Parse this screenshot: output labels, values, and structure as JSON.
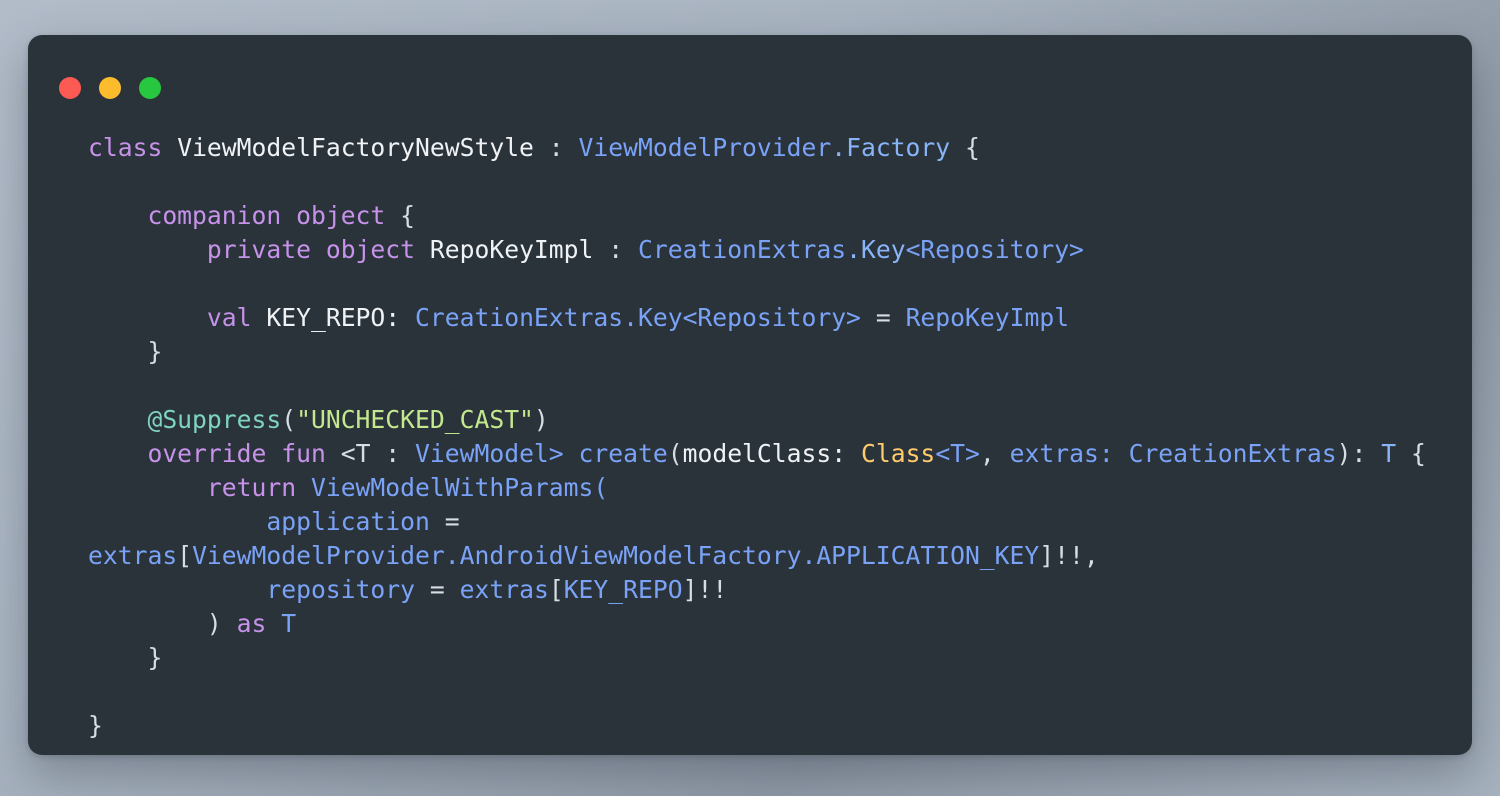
{
  "window": {
    "background_color": "#2a333a",
    "page_background_color": "#a9b4c1",
    "controls": [
      {
        "name": "close",
        "label": "Close",
        "color": "#fc5b54"
      },
      {
        "name": "minimize",
        "label": "Minimize",
        "color": "#fdbc2e"
      },
      {
        "name": "maximize",
        "label": "Maximize",
        "color": "#27c83f"
      }
    ]
  },
  "palette": {
    "keyword": "#c792ea",
    "identifier": "#f0f3f6",
    "type_reference": "#7aa2f7",
    "annotation": "#7fd4c1",
    "string": "#c3e88d",
    "gold_type": "#ffcb6b",
    "punctuation": "#d7dde3"
  },
  "code": {
    "language": "Kotlin",
    "lines": [
      "class ViewModelFactoryNewStyle : ViewModelProvider.Factory {",
      "",
      "    companion object {",
      "        private object RepoKeyImpl : CreationExtras.Key<Repository>",
      "",
      "        val KEY_REPO: CreationExtras.Key<Repository> = RepoKeyImpl",
      "    }",
      "",
      "    @Suppress(\"UNCHECKED_CAST\")",
      "    override fun <T : ViewModel> create(modelClass: Class<T>, extras: CreationExtras): T {",
      "        return ViewModelWithParams(",
      "            application =",
      "extras[ViewModelProvider.AndroidViewModelFactory.APPLICATION_KEY]!!,",
      "            repository = extras[KEY_REPO]!!",
      "        ) as T",
      "    }",
      "",
      "}"
    ],
    "tokens": {
      "l1": {
        "kw": "class",
        "name": "ViewModelFactoryNewStyle",
        "colon": ":",
        "super": "ViewModelProvider",
        "dot_member": ".Factory",
        "brace": "{"
      },
      "l3": {
        "kw1": "companion",
        "kw2": "object",
        "brace": "{"
      },
      "l4": {
        "kw1": "private",
        "kw2": "object",
        "name": "RepoKeyImpl",
        "colon": ":",
        "type": "CreationExtras",
        "member": ".Key",
        "generic": "<Repository>"
      },
      "l6": {
        "kw": "val",
        "name": "KEY_REPO:",
        "type": "CreationExtras.Key<Repository>",
        "eq": "=",
        "value": "RepoKeyImpl"
      },
      "l7": {
        "brace": "}"
      },
      "l9": {
        "annotation": "@Suppress",
        "open": "(",
        "string": "\"UNCHECKED_CAST\"",
        "close": ")"
      },
      "l10": {
        "kw1": "override",
        "kw2": "fun",
        "generic_open": "<T :",
        "generic_type": "ViewModel>",
        "fn": "create",
        "paren": "(",
        "param1": "modelClass:",
        "param1_type": "Class",
        "param1_generic": "<T>",
        "comma": ",",
        "param2": "extras:",
        "param2_type": "CreationExtras",
        "close": "):",
        "return_type": "T",
        "brace": "{"
      },
      "l11": {
        "kw": "return",
        "call": "ViewModelWithParams("
      },
      "l12": {
        "arg": "application",
        "eq": "="
      },
      "l13": {
        "obj": "extras",
        "bracket_open": "[",
        "key": "ViewModelProvider.AndroidViewModelFactory.APPLICATION_KEY",
        "bracket_close": "]",
        "bangs": "!!",
        "comma": ","
      },
      "l14": {
        "arg": "repository",
        "eq": "=",
        "obj": "extras",
        "bracket_open": "[",
        "key": "KEY_REPO",
        "bracket_close": "]",
        "bangs": "!!"
      },
      "l15": {
        "paren": ")",
        "kw": "as",
        "type": "T"
      },
      "l16": {
        "brace": "}"
      },
      "l18": {
        "brace": "}"
      }
    }
  }
}
